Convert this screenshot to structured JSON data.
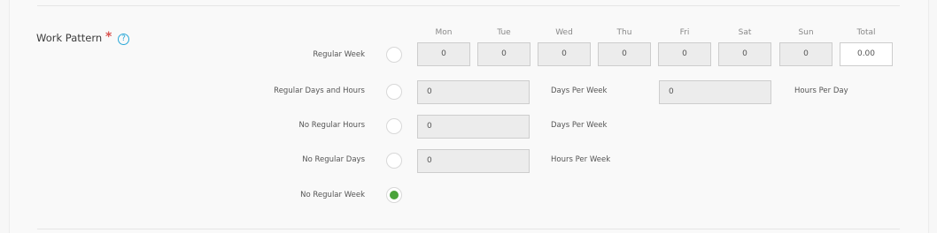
{
  "section": {
    "label": "Work Pattern",
    "required_mark": "*",
    "help_icon": "?"
  },
  "days": [
    "Mon",
    "Tue",
    "Wed",
    "Thu",
    "Fri",
    "Sat",
    "Sun"
  ],
  "total_label": "Total",
  "regular_week": {
    "label": "Regular Week",
    "values": [
      "0",
      "0",
      "0",
      "0",
      "0",
      "0",
      "0"
    ],
    "total": "0.00",
    "selected": false
  },
  "regular_days_hours": {
    "label": "Regular Days and Hours",
    "days_value": "0",
    "days_unit": "Days Per Week",
    "hours_value": "0",
    "hours_unit": "Hours Per Day",
    "selected": false
  },
  "no_regular_hours": {
    "label": "No Regular Hours",
    "value": "0",
    "unit": "Days Per Week",
    "selected": false
  },
  "no_regular_days": {
    "label": "No Regular Days",
    "value": "0",
    "unit": "Hours Per Week",
    "selected": false
  },
  "no_regular_week": {
    "label": "No Regular Week",
    "selected": true
  },
  "colors": {
    "required": "#d9534f",
    "help": "#2aa8d8",
    "radio_selected": "#4aa33a"
  }
}
